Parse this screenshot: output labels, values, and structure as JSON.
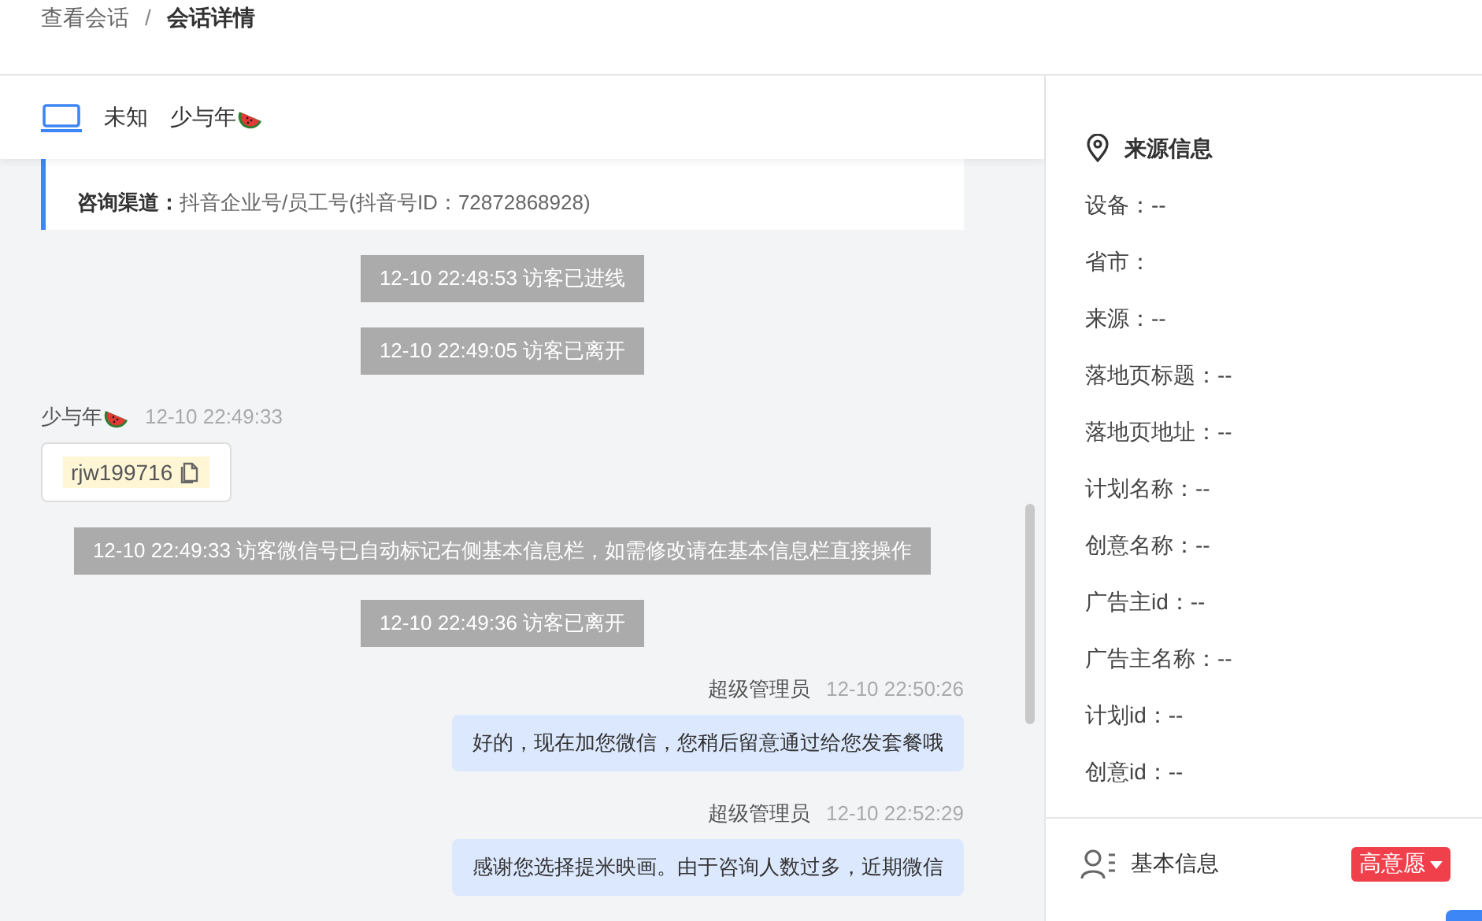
{
  "breadcrumb": [
    {
      "label": "查看会话",
      "current": false
    },
    {
      "label": "会话详情",
      "current": true
    }
  ],
  "breadcrumb_separator": "/",
  "header": {
    "device": "未知",
    "visitor_name": "少与年"
  },
  "channel_info": [
    {
      "label": "咨询渠道：",
      "value": "抖音企业号/员工号(抖音号ID：72872868928)"
    }
  ],
  "messages": [
    {
      "kind": "system",
      "text": "12-10 22:48:53 访客已进线"
    },
    {
      "kind": "system",
      "text": "12-10 22:49:05 访客已离开"
    },
    {
      "kind": "visitor",
      "sender": "少与年",
      "time": "12-10 22:49:33",
      "text": "rjw199716"
    },
    {
      "kind": "system",
      "text": "12-10 22:49:33 访客微信号已自动标记右侧基本信息栏，如需修改请在基本信息栏直接操作"
    },
    {
      "kind": "system",
      "text": "12-10 22:49:36 访客已离开"
    },
    {
      "kind": "agent",
      "sender": "超级管理员",
      "time": "12-10 22:50:26",
      "text": "好的，现在加您微信，您稍后留意通过给您发套餐哦"
    },
    {
      "kind": "agent",
      "sender": "超级管理员",
      "time": "12-10 22:52:29",
      "text": "感谢您选择提米映画。由于咨询人数过多，近期微信"
    }
  ],
  "source_info": {
    "title": "来源信息",
    "fields": [
      "设备：--",
      "省市：",
      "来源：--",
      "落地页标题：--",
      "落地页地址：--",
      "计划名称：--",
      "创意名称：--",
      "广告主id：--",
      "广告主名称：--",
      "计划id：--",
      "创意id：--"
    ]
  },
  "basic_info": {
    "title": "基本信息",
    "intent_tag": "高意愿"
  }
}
